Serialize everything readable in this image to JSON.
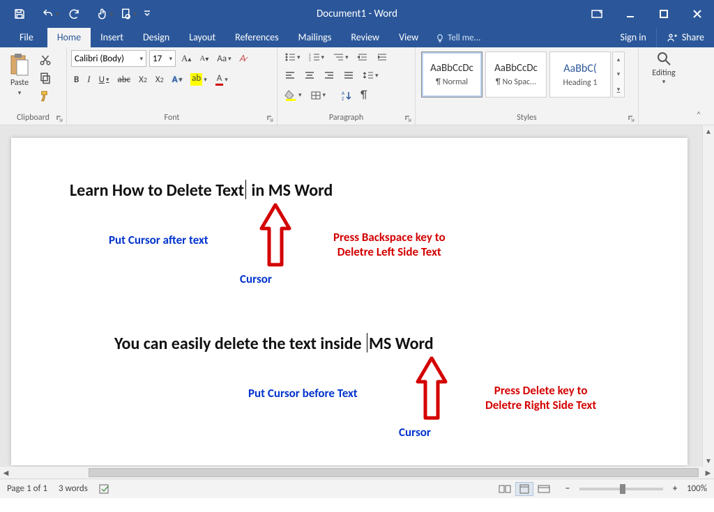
{
  "title": "Document1 - Word",
  "menu": {
    "file": "File",
    "home": "Home",
    "insert": "Insert",
    "design": "Design",
    "layout": "Layout",
    "references": "References",
    "mailings": "Mailings",
    "review": "Review",
    "view": "View",
    "tellme": "Tell me...",
    "signin": "Sign in",
    "share": "Share"
  },
  "ribbon": {
    "clipboard": {
      "paste": "Paste",
      "label": "Clipboard"
    },
    "font": {
      "name": "Calibri (Body)",
      "size": "17",
      "label": "Font"
    },
    "paragraph": {
      "label": "Paragraph"
    },
    "styles": {
      "label": "Styles",
      "items": [
        {
          "preview": "AaBbCcDc",
          "name": "¶ Normal"
        },
        {
          "preview": "AaBbCcDc",
          "name": "¶ No Spac..."
        },
        {
          "preview": "AaBbC(",
          "name": "Heading 1"
        }
      ]
    },
    "editing": {
      "label": "Editing"
    }
  },
  "doc": {
    "h1a": "Learn How to Delete Text",
    "h1b": " in MS Word",
    "l1": "Put Cursor after text",
    "r1a": "Press Backspace key to",
    "r1b": "Deletre Left Side Text",
    "cur1": "Cursor",
    "h2a": "You can easily delete the text inside ",
    "h2b": "MS Word",
    "l2": "Put Cursor before Text",
    "r2a": "Press Delete key to",
    "r2b": "Deletre Right Side Text",
    "cur2": "Cursor"
  },
  "status": {
    "page": "Page 1 of 1",
    "words": "3 words",
    "zoom": "100%"
  }
}
